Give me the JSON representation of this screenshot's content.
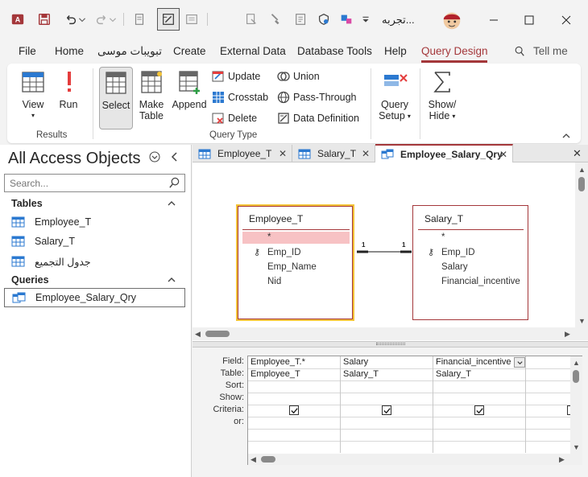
{
  "titlebar": {
    "app_title": "تجربه...",
    "colors": {
      "access_red": "#a4373a",
      "accent": "#a4373a"
    }
  },
  "menu": {
    "tabs": [
      {
        "label": "File"
      },
      {
        "label": "Home"
      },
      {
        "label": "تبويبات موسى"
      },
      {
        "label": "Create"
      },
      {
        "label": "External Data"
      },
      {
        "label": "Database Tools"
      },
      {
        "label": "Help"
      },
      {
        "label": "Query Design"
      }
    ],
    "active": "Query Design",
    "tell_me": "Tell me"
  },
  "ribbon": {
    "results": {
      "view": "View",
      "run": "Run",
      "label": "Results"
    },
    "query_type": {
      "select": "Select",
      "make_table_1": "Make",
      "make_table_2": "Table",
      "append": "Append",
      "update": "Update",
      "crosstab": "Crosstab",
      "delete": "Delete",
      "union": "Union",
      "pass_through": "Pass-Through",
      "data_definition": "Data Definition",
      "label": "Query Type"
    },
    "query_setup_1": "Query",
    "query_setup_2": "Setup",
    "show_hide_1": "Show/",
    "show_hide_2": "Hide"
  },
  "nav": {
    "title": "All Access Objects",
    "search_placeholder": "Search...",
    "groups": {
      "tables": "Tables",
      "queries": "Queries"
    },
    "tables": [
      "Employee_T",
      "Salary_T",
      "جدول التجميع"
    ],
    "queries": [
      "Employee_Salary_Qry"
    ]
  },
  "doctabs": [
    {
      "label": "Employee_T"
    },
    {
      "label": "Salary_T"
    },
    {
      "label": "Employee_Salary_Qry"
    }
  ],
  "design": {
    "employee_table": {
      "title": "Employee_T",
      "fields": [
        "*",
        "Emp_ID",
        "Emp_Name",
        "Nid"
      ]
    },
    "salary_table": {
      "title": "Salary_T",
      "fields": [
        "*",
        "Emp_ID",
        "Salary",
        "Financial_incentive"
      ]
    },
    "join": {
      "left_card": "1",
      "right_card": "1"
    }
  },
  "grid": {
    "row_labels": [
      "Field:",
      "Table:",
      "Sort:",
      "Show:",
      "Criteria:",
      "or:"
    ],
    "columns": [
      {
        "field": "Employee_T.*",
        "table": "Employee_T",
        "show": true
      },
      {
        "field": "Salary",
        "table": "Salary_T",
        "show": true
      },
      {
        "field": "Financial_incentive",
        "table": "Salary_T",
        "show": true
      },
      {
        "field": "",
        "table": "",
        "show": false
      }
    ]
  }
}
